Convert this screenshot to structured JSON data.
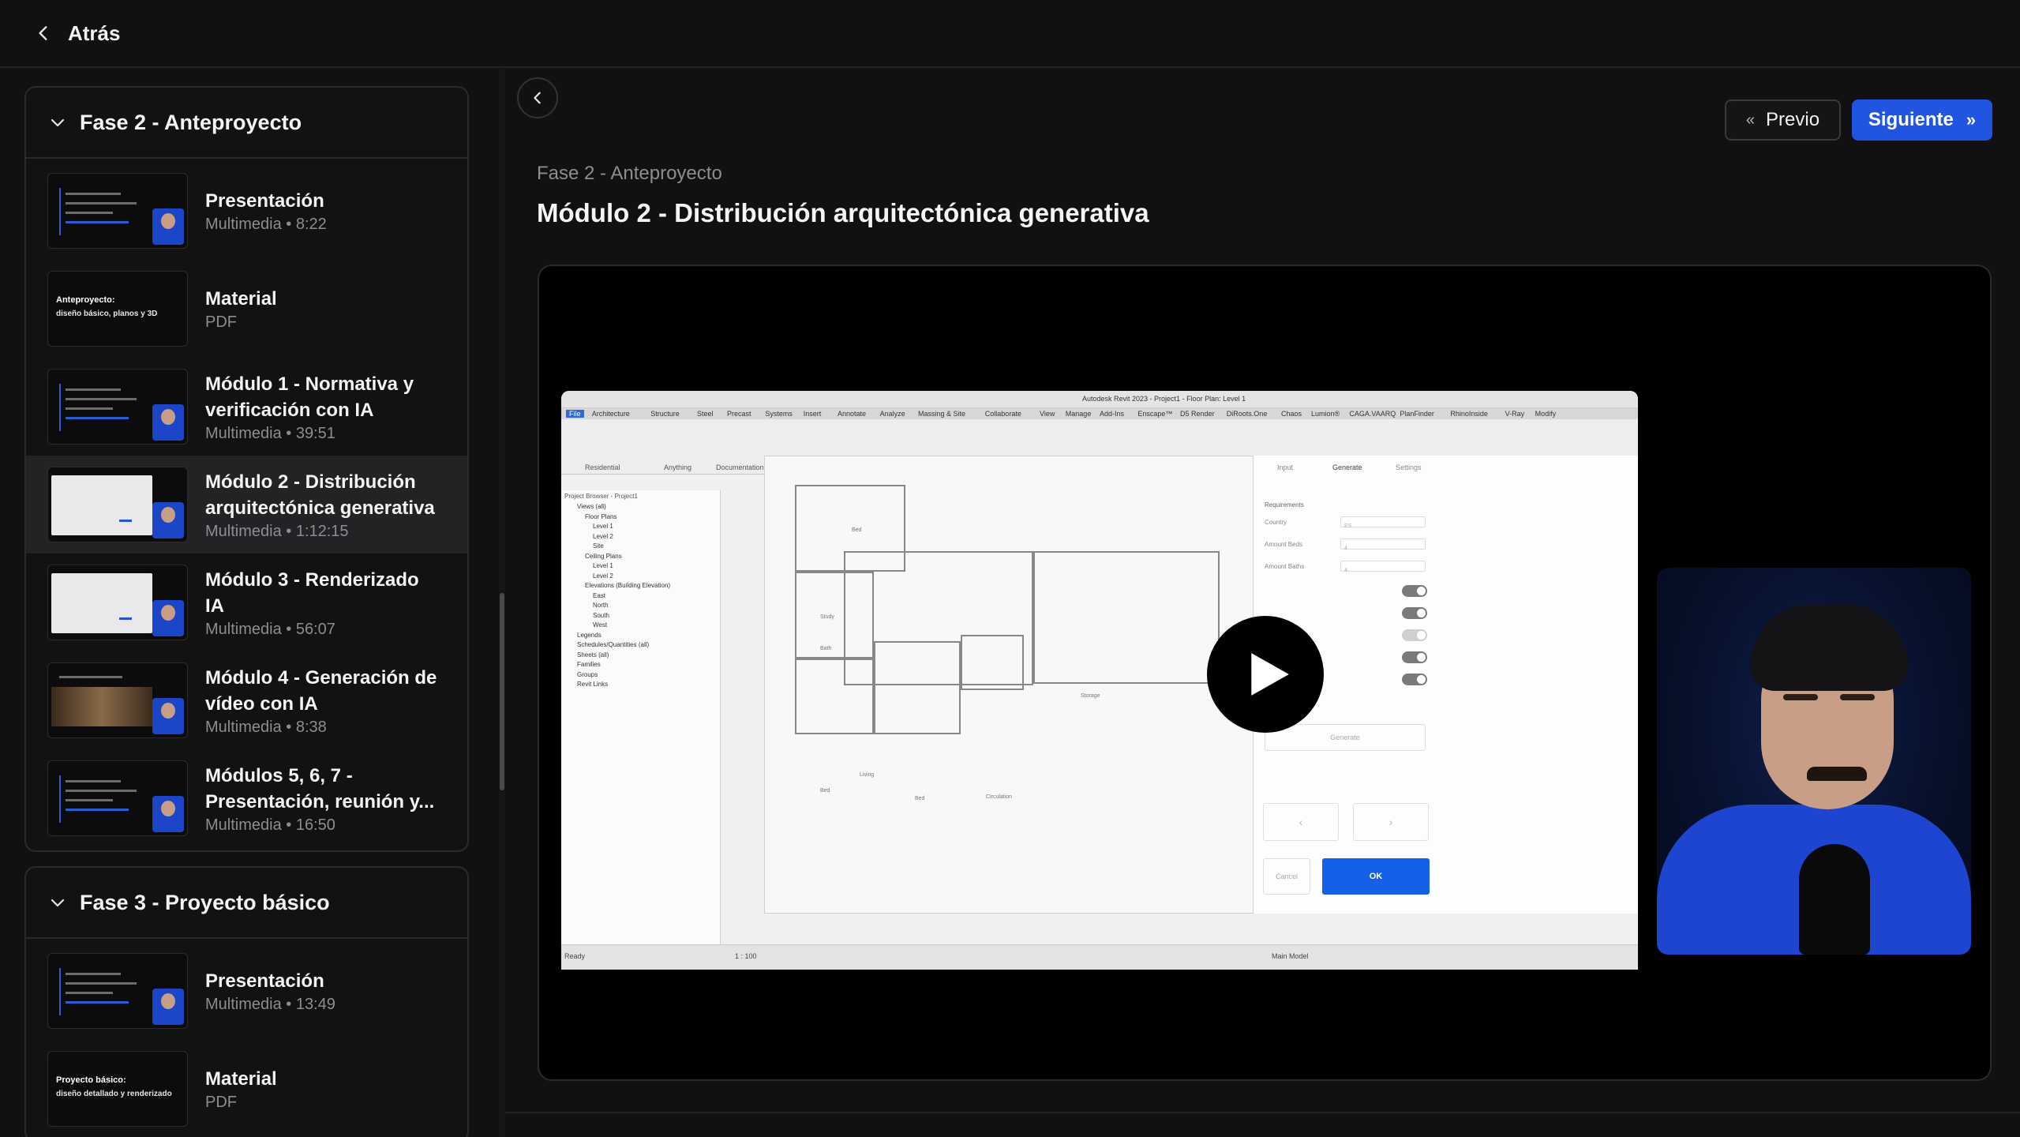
{
  "header": {
    "back_label": "Atrás"
  },
  "sidebar": {
    "phases": [
      {
        "title": "Fase 2 - Anteproyecto",
        "lessons": [
          {
            "title": "Presentación",
            "meta": "Multimedia • 8:22",
            "thumb": "video"
          },
          {
            "title": "Material",
            "meta": "PDF",
            "thumb": "doc",
            "doc_title": "Anteproyecto:",
            "doc_sub": "diseño básico, planos y 3D"
          },
          {
            "title": "Módulo 1 - Normativa y verificación con IA",
            "meta": "Multimedia • 39:51",
            "thumb": "video"
          },
          {
            "title": "Módulo 2 - Distribución arquitectónica generativa",
            "meta": "Multimedia • 1:12:15",
            "thumb": "light",
            "active": true
          },
          {
            "title": "Módulo 3 - Renderizado IA",
            "meta": "Multimedia • 56:07",
            "thumb": "light"
          },
          {
            "title": "Módulo 4 - Generación de vídeo con IA",
            "meta": "Multimedia • 8:38",
            "thumb": "warm"
          },
          {
            "title": "Módulos 5, 6, 7 - Presentación, reunión y...",
            "meta": "Multimedia • 16:50",
            "thumb": "video"
          }
        ]
      },
      {
        "title": "Fase 3 - Proyecto básico",
        "lessons": [
          {
            "title": "Presentación",
            "meta": "Multimedia • 13:49",
            "thumb": "video"
          },
          {
            "title": "Material",
            "meta": "PDF",
            "thumb": "doc",
            "doc_title": "Proyecto básico:",
            "doc_sub": "diseño detallado y renderizado"
          }
        ]
      }
    ]
  },
  "main": {
    "prev_label": "Previo",
    "next_label": "Siguiente",
    "breadcrumb": "Fase 2 - Anteproyecto",
    "title": "Módulo 2 - Distribución arquitectónica generativa"
  },
  "video": {
    "app_title": "Autodesk Revit 2023 - Project1 - Floor Plan: Level 1",
    "menu": [
      "File",
      "Architecture",
      "Structure",
      "Steel",
      "Precast",
      "Systems",
      "Insert",
      "Annotate",
      "Analyze",
      "Massing & Site",
      "Collaborate",
      "View",
      "Manage",
      "Add-Ins",
      "Enscape™",
      "D5 Render",
      "DiRoots.One",
      "Chaos",
      "Lumion®",
      "CAGA.VAARQ",
      "PlanFinder",
      "RhinoInside",
      "V-Ray",
      "Modify"
    ],
    "toolbar_groups": [
      "Residential",
      "Anything",
      "Documentation"
    ],
    "browser_title": "Project Browser - Project1",
    "tree": [
      "Views (all)",
      "Floor Plans",
      "Level 1",
      "Level 2",
      "Site",
      "Ceiling Plans",
      "Level 1",
      "Level 2",
      "Elevations (Building Elevation)",
      "East",
      "North",
      "South",
      "West",
      "Legends",
      "Schedules/Quantities (all)",
      "Sheets (all)",
      "Families",
      "Groups",
      "Revit Links"
    ],
    "panel_tabs": [
      "Input",
      "Generate",
      "Settings"
    ],
    "panel_section": "Requirements",
    "panel_fields": [
      "Country",
      "Amount Beds",
      "Amount Baths"
    ],
    "panel_values": [
      "ES",
      "4",
      "4"
    ],
    "generate_label": "Generate",
    "cancel_label": "Cancel",
    "ok_label": "OK",
    "status_left": "Ready",
    "status_model": "Main Model",
    "scale": "1 : 100",
    "rooms": [
      "Bed",
      "Study",
      "Bath",
      "Living",
      "Bed",
      "Bed",
      "Circulation",
      "Storage"
    ]
  },
  "colors": {
    "accent": "#1f55e0",
    "background": "#111112",
    "active_row": "#232325"
  }
}
